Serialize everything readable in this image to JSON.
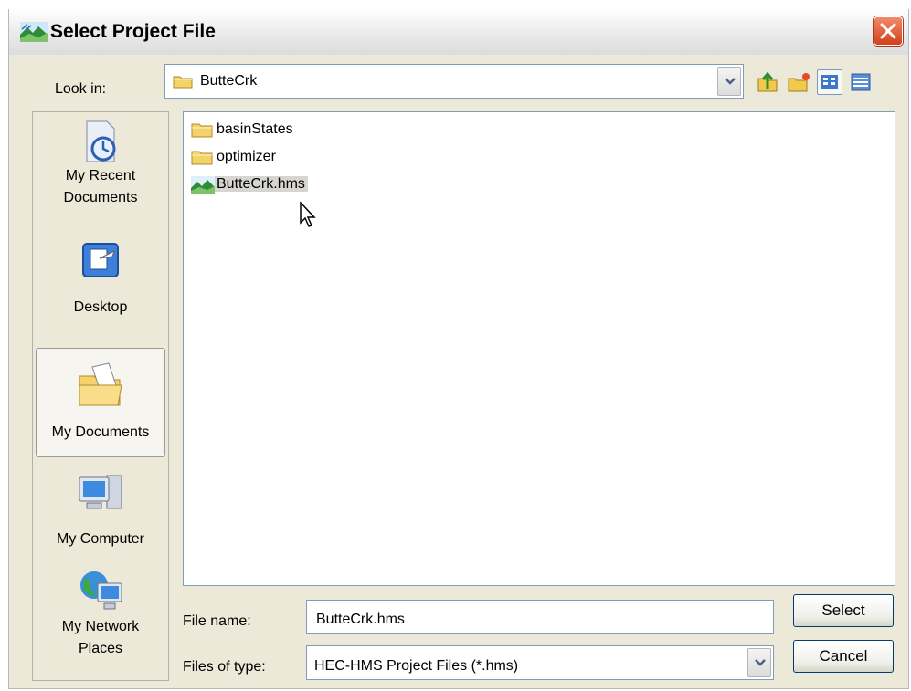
{
  "window": {
    "title": "Select Project File"
  },
  "look_in": {
    "label": "Look in:",
    "value": "ButteCrk"
  },
  "toolbar": [
    {
      "icon": "up-one-level-icon"
    },
    {
      "icon": "create-new-folder-icon"
    },
    {
      "icon": "list-view-icon",
      "selected": true
    },
    {
      "icon": "details-view-icon"
    }
  ],
  "places": [
    {
      "label_line1": "My Recent",
      "label_line2": "Documents",
      "icon": "recent-documents-icon"
    },
    {
      "label_line1": "Desktop",
      "label_line2": "",
      "icon": "desktop-icon"
    },
    {
      "label_line1": "My Documents",
      "label_line2": "",
      "icon": "my-documents-icon",
      "active": true
    },
    {
      "label_line1": "My Computer",
      "label_line2": "",
      "icon": "my-computer-icon"
    },
    {
      "label_line1": "My Network",
      "label_line2": "Places",
      "icon": "network-places-icon"
    }
  ],
  "files": [
    {
      "name": "basinStates",
      "type": "folder"
    },
    {
      "name": "optimizer",
      "type": "folder"
    },
    {
      "name": "ButteCrk.hms",
      "type": "hms-file",
      "selected": true
    }
  ],
  "file_name": {
    "label": "File name:",
    "value": "ButteCrk.hms"
  },
  "file_type": {
    "label": "Files of type:",
    "value": "HEC-HMS Project Files (*.hms)"
  },
  "buttons": {
    "select": "Select",
    "cancel": "Cancel"
  }
}
